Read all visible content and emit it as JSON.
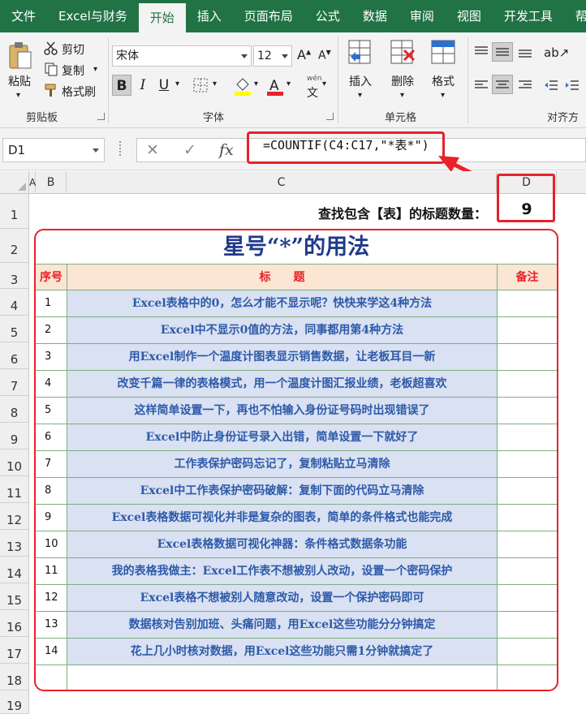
{
  "ribbon": {
    "tabs": [
      "文件",
      "Excel与财务",
      "开始",
      "插入",
      "页面布局",
      "公式",
      "数据",
      "审阅",
      "视图",
      "开发工具",
      "帮"
    ],
    "active_tab": "开始",
    "clipboard": {
      "paste": "粘贴",
      "cut": "剪切",
      "copy": "复制",
      "format_painter": "格式刷",
      "label": "剪贴板"
    },
    "font": {
      "name": "宋体",
      "size": "12",
      "bold": "B",
      "italic": "I",
      "underline": "U",
      "label": "字体",
      "wen": "wén"
    },
    "cells": {
      "insert": "插入",
      "delete": "删除",
      "format": "格式",
      "label": "单元格"
    },
    "alignment": {
      "label": "对齐方"
    }
  },
  "formula_bar": {
    "name_box": "D1",
    "cancel": "✕",
    "enter": "✓",
    "fx": "fx",
    "formula": "=COUNTIF(C4:C17,\"*表*\")"
  },
  "sheet": {
    "columns": [
      "A",
      "B",
      "C",
      "D"
    ],
    "rows": [
      "1",
      "2",
      "3",
      "4",
      "5",
      "6",
      "7",
      "8",
      "9",
      "10",
      "11",
      "12",
      "13",
      "14",
      "15",
      "16",
      "17",
      "18",
      "19"
    ],
    "count_label": "查找包含【表】的标题数量：",
    "count_value": "9",
    "table_title": "星号“*”的用法",
    "headers": {
      "no": "序号",
      "title": "标　　题",
      "note": "备注"
    },
    "items": [
      {
        "no": "1",
        "title": "Excel表格中的0，怎么才能不显示呢？快快来学这4种方法"
      },
      {
        "no": "2",
        "title": "Excel中不显示0值的方法，同事都用第4种方法"
      },
      {
        "no": "3",
        "title": "用Excel制作一个温度计图表显示销售数据，让老板耳目一新"
      },
      {
        "no": "4",
        "title": "改变千篇一律的表格模式，用一个温度计图汇报业绩，老板超喜欢"
      },
      {
        "no": "5",
        "title": "这样简单设置一下，再也不怕输入身份证号码时出现错误了"
      },
      {
        "no": "6",
        "title": "Excel中防止身份证号录入出错，简单设置一下就好了"
      },
      {
        "no": "7",
        "title": "工作表保护密码忘记了，复制粘贴立马清除"
      },
      {
        "no": "8",
        "title": "Excel中工作表保护密码破解：复制下面的代码立马清除"
      },
      {
        "no": "9",
        "title": "Excel表格数据可视化并非是复杂的图表，简单的条件格式也能完成"
      },
      {
        "no": "10",
        "title": "Excel表格数据可视化神器：条件格式数据条功能"
      },
      {
        "no": "11",
        "title": "我的表格我做主：Excel工作表不想被别人改动，设置一个密码保护"
      },
      {
        "no": "12",
        "title": "Excel表格不想被别人随意改动，设置一个保护密码即可"
      },
      {
        "no": "13",
        "title": "数据核对告别加班、头痛问题，用Excel这些功能分分钟搞定"
      },
      {
        "no": "14",
        "title": "花上几小时核对数据，用Excel这些功能只需1分钟就搞定了"
      }
    ]
  },
  "colors": {
    "brand": "#217346",
    "highlight": "#e8212a",
    "title_blue": "#1f3a8a",
    "row_fill": "#d9e1f2",
    "header_fill": "#fbe5d3"
  }
}
